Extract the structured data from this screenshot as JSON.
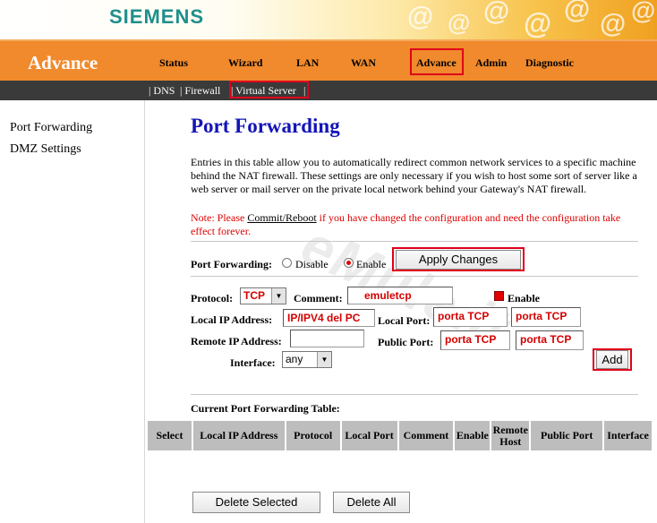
{
  "header": {
    "brand": "SIEMENS",
    "section_title": "Advance",
    "nav": [
      "Status",
      "Wizard",
      "LAN",
      "WAN",
      "Advance",
      "Admin",
      "Diagnostic"
    ],
    "active_nav": "Advance",
    "subnav": [
      "| DNS",
      "| Firewall",
      "| Virtual Server",
      "|"
    ]
  },
  "sidebar": {
    "items": [
      "Port Forwarding",
      "DMZ Settings"
    ]
  },
  "main": {
    "title": "Port Forwarding",
    "description": "Entries in this table allow you to automatically redirect common network services to a specific machine behind the NAT firewall. These settings are only necessary if you wish to host some sort of server like a web server or mail server on the private local network behind your Gateway's NAT firewall.",
    "note_prefix": "Note: Please ",
    "note_link": "Commit/Reboot",
    "note_suffix": " if you have changed the configuration and need the configuration take effect forever.",
    "pf_label": "Port Forwarding:",
    "disable_label": "Disable",
    "enable_label": "Enable",
    "pf_enabled": true,
    "apply_button": "Apply Changes",
    "protocol_label": "Protocol:",
    "protocol_value": "TCP",
    "comment_label": "Comment:",
    "comment_value": "emuletcp",
    "enable_check_label": "Enable",
    "local_ip_label": "Local IP Address:",
    "local_ip_value": "IP/IPV4 del PC",
    "local_port_label": "Local Port:",
    "local_port_from": "porta TCP",
    "local_port_to": "porta TCP",
    "remote_ip_label": "Remote IP Address:",
    "remote_ip_value": "",
    "public_port_label": "Public Port:",
    "public_port_from": "porta TCP",
    "public_port_to": "porta TCP",
    "interface_label": "Interface:",
    "interface_value": "any",
    "add_button": "Add",
    "table_title": "Current Port Forwarding Table:",
    "table_headers": [
      "Select",
      "Local IP Address",
      "Protocol",
      "Local Port",
      "Comment",
      "Enable",
      "Remote Host",
      "Public Port",
      "Interface"
    ],
    "delete_selected_button": "Delete Selected",
    "delete_all_button": "Delete All",
    "watermark": "eMule.it"
  }
}
